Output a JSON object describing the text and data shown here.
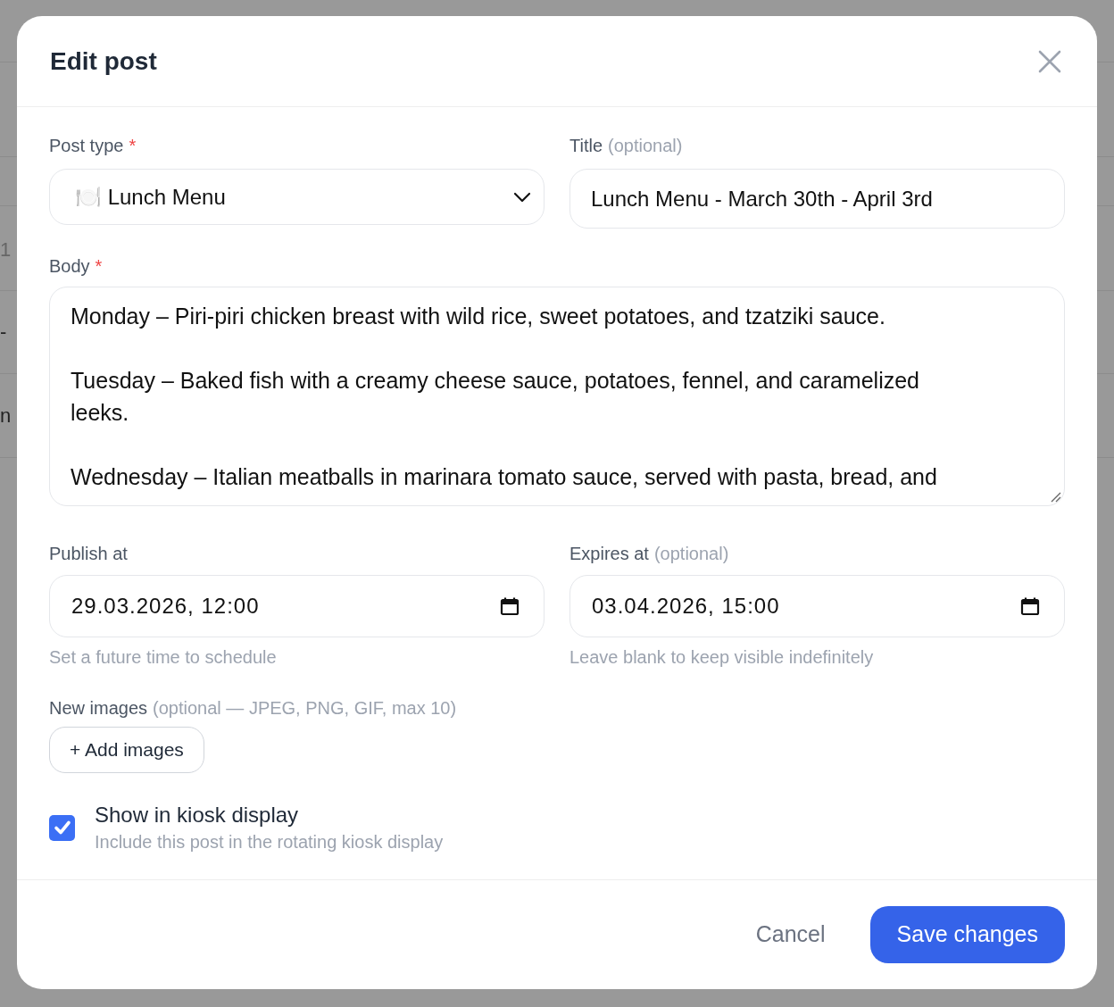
{
  "background": {
    "left_cells": [
      "1",
      "-",
      "n"
    ]
  },
  "dialog": {
    "title": "Edit post",
    "post_type": {
      "label": "Post type",
      "required_mark": "*",
      "value": "🍽️ Lunch Menu"
    },
    "title_field": {
      "label": "Title",
      "hint": "(optional)",
      "value": "Lunch Menu - March 30th - April 3rd"
    },
    "body": {
      "label": "Body",
      "required_mark": "*",
      "value": "Monday – Piri-piri chicken breast with wild rice, sweet potatoes, and tzatziki sauce.\n\nTuesday – Baked fish with a creamy cheese sauce, potatoes, fennel, and caramelized leeks.\n\nWednesday – Italian meatballs in marinara tomato sauce, served with pasta, bread, and"
    },
    "publish_at": {
      "label": "Publish at",
      "value": "29.03.2026, 12:00",
      "help": "Set a future time to schedule"
    },
    "expires_at": {
      "label": "Expires at",
      "hint": "(optional)",
      "value": "03.04.2026, 15:00",
      "help": "Leave blank to keep visible indefinitely"
    },
    "images": {
      "label": "New images",
      "hint": "(optional — JPEG, PNG, GIF, max 10)",
      "button": "+ Add images"
    },
    "kiosk": {
      "label": "Show in kiosk display",
      "description": "Include this post in the rotating kiosk display",
      "checked": true
    },
    "buttons": [
      "Cancel",
      "Save changes"
    ]
  }
}
